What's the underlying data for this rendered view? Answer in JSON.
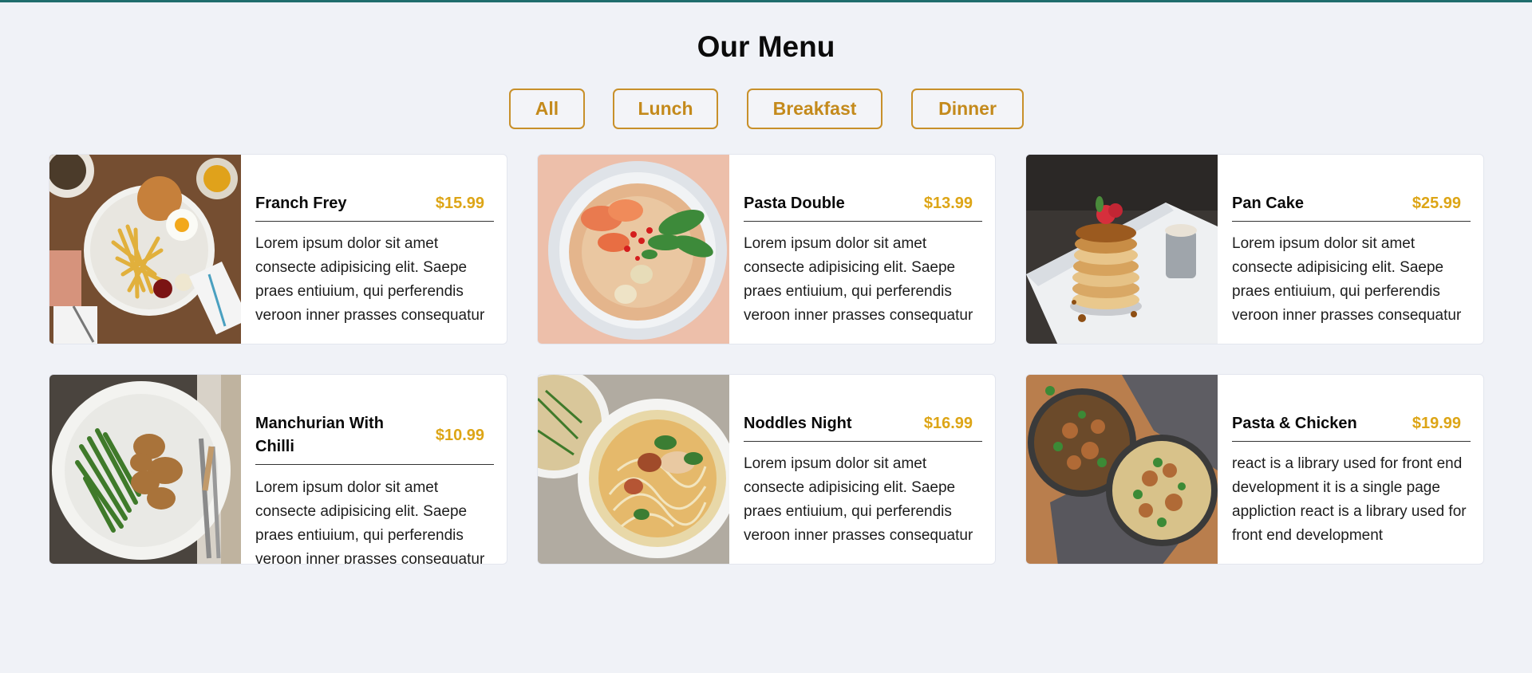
{
  "page": {
    "title": "Our Menu"
  },
  "filters": [
    {
      "label": "All"
    },
    {
      "label": "Lunch"
    },
    {
      "label": "Breakfast"
    },
    {
      "label": "Dinner"
    }
  ],
  "colors": {
    "accent": "#c8902a",
    "price": "#dda516",
    "background": "#f0f2f7",
    "top_bar": "#1f6d6d"
  },
  "items": [
    {
      "name": "Franch Frey",
      "price": "$15.99",
      "description": "Lorem ipsum dolor sit amet consecte adipisicing elit. Saepe praes entiuium, qui perferendis veroon inner prasses consequatur",
      "image": "burger-fries-plate"
    },
    {
      "name": "Pasta Double",
      "price": "$13.99",
      "description": "Lorem ipsum dolor sit amet consecte adipisicing elit. Saepe praes entiuium, qui perferendis veroon inner prasses consequatur",
      "image": "shrimp-noodle-bowl"
    },
    {
      "name": "Pan Cake",
      "price": "$25.99",
      "description": "Lorem ipsum dolor sit amet consecte adipisicing elit. Saepe praes entiuium, qui perferendis veroon inner prasses consequatur",
      "image": "pancake-stack"
    },
    {
      "name": "Manchurian With Chilli",
      "price": "$10.99",
      "description": "Lorem ipsum dolor sit amet consecte adipisicing elit. Saepe praes entiuium, qui perferendis veroon inner prasses consequatur",
      "image": "green-beans-chicken-plate"
    },
    {
      "name": "Noddles Night",
      "price": "$16.99",
      "description": "Lorem ipsum dolor sit amet consecte adipisicing elit. Saepe praes entiuium, qui perferendis veroon inner prasses consequatur",
      "image": "noodle-soup-bowl"
    },
    {
      "name": "Pasta & Chicken",
      "price": "$19.99",
      "description": "react is a library used for front end development it is a single page appliction react is a library used for front end development",
      "image": "mushroom-bowls"
    }
  ]
}
